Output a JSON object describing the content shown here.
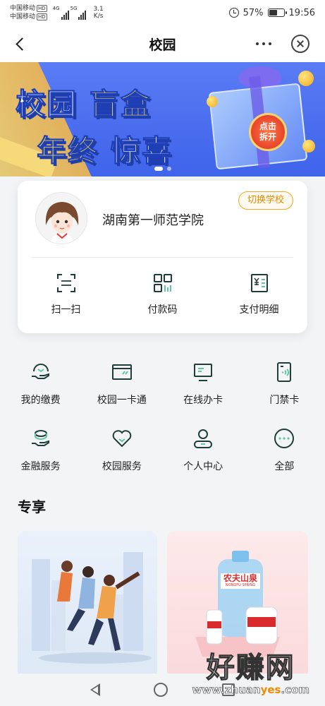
{
  "status_bar": {
    "carrier1": "中国移动",
    "carrier2": "中国移动",
    "hd_badge": "HD",
    "net1": "4G",
    "net2": "5G",
    "speed_value": "3.1",
    "speed_unit": "K/s",
    "battery": "57%",
    "battery_level": 0.57,
    "time": "19:56"
  },
  "nav": {
    "title": "校园"
  },
  "banner": {
    "line1_a": "校园",
    "line1_b": "盲盒",
    "line2_a": "年终",
    "line2_b": "惊喜",
    "badge_line1": "点击",
    "badge_line2": "拆开"
  },
  "school_card": {
    "school_name": "湖南第一师范学院",
    "switch_label": "切换学校",
    "actions": [
      {
        "label": "扫一扫",
        "icon": "scan-icon"
      },
      {
        "label": "付款码",
        "icon": "payment-code-icon"
      },
      {
        "label": "支付明细",
        "icon": "bill-details-icon"
      }
    ]
  },
  "services": [
    {
      "label": "我的缴费",
      "icon": "payment-hand-icon"
    },
    {
      "label": "校园一卡通",
      "icon": "campus-card-icon"
    },
    {
      "label": "在线办卡",
      "icon": "online-card-icon"
    },
    {
      "label": "门禁卡",
      "icon": "access-card-icon"
    },
    {
      "label": "金融服务",
      "icon": "finance-icon"
    },
    {
      "label": "校园服务",
      "icon": "heart-service-icon"
    },
    {
      "label": "个人中心",
      "icon": "person-icon"
    },
    {
      "label": "全部",
      "icon": "more-dots-icon"
    }
  ],
  "section": {
    "title": "专享"
  },
  "promo_right": {
    "brand": "农夫山泉",
    "brand_en": "NONGFU SPRING"
  },
  "watermark": {
    "cn": "好赚网",
    "url_a": "www.zhuan",
    "url_b": "yes",
    "url_c": ".com"
  },
  "colors": {
    "accent": "#f6a623",
    "icon": "#1f3d3a",
    "banner_blue": "#3f63ea"
  }
}
